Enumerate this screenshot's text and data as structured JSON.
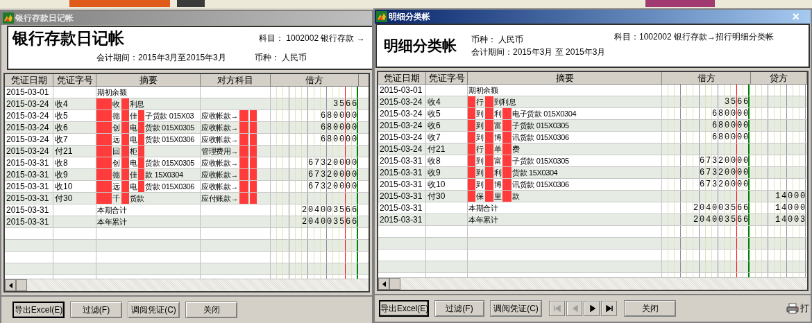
{
  "ledger_window": {
    "title": "银行存款日记帐",
    "active": false,
    "heading": "银行存款日记帐",
    "subject": "科目： 1002002 银行存款 →",
    "period": "会计期间：2015年3月至2015年3月",
    "currency": "币种： 人民币",
    "columns": [
      "凭证日期",
      "凭证字号",
      "摘要",
      "对方科目",
      "借方"
    ],
    "rows": [
      {
        "date": "2015-03-01",
        "summary": [
          {
            "kind": "text",
            "text": "期初余额"
          }
        ]
      },
      {
        "date": "2015-03-24",
        "voucher": "收4",
        "summary": [
          {
            "kind": "redacted"
          },
          {
            "kind": "text",
            "text": "收"
          },
          {
            "kind": "redacted"
          },
          {
            "kind": "text",
            "text": "利息"
          }
        ],
        "debit": "3566"
      },
      {
        "date": "2015-03-24",
        "voucher": "收5",
        "summary": [
          {
            "kind": "redacted"
          },
          {
            "kind": "text",
            "text": "德"
          },
          {
            "kind": "redacted"
          },
          {
            "kind": "text",
            "text": "佳"
          },
          {
            "kind": "redacted"
          },
          {
            "kind": "text",
            "text": "子货款 015X03"
          }
        ],
        "counterpart": [
          {
            "kind": "text",
            "text": "应收帐款→"
          },
          {
            "kind": "redacted"
          },
          {
            "kind": "redacted"
          }
        ],
        "debit": "680000"
      },
      {
        "date": "2015-03-24",
        "voucher": "收6",
        "summary": [
          {
            "kind": "redacted"
          },
          {
            "kind": "text",
            "text": "创"
          },
          {
            "kind": "redacted"
          },
          {
            "kind": "text",
            "text": "电"
          },
          {
            "kind": "redacted"
          },
          {
            "kind": "text",
            "text": "货款 015X0305"
          }
        ],
        "counterpart": [
          {
            "kind": "text",
            "text": "应收帐款→"
          },
          {
            "kind": "redacted"
          },
          {
            "kind": "redacted"
          }
        ],
        "debit": "680000"
      },
      {
        "date": "2015-03-24",
        "voucher": "收7",
        "summary": [
          {
            "kind": "redacted"
          },
          {
            "kind": "text",
            "text": "远"
          },
          {
            "kind": "redacted"
          },
          {
            "kind": "text",
            "text": "电"
          },
          {
            "kind": "redacted"
          },
          {
            "kind": "text",
            "text": "货款 015X0306"
          }
        ],
        "counterpart": [
          {
            "kind": "text",
            "text": "应收帐款→"
          },
          {
            "kind": "redacted"
          },
          {
            "kind": "redacted"
          }
        ],
        "debit": "680000"
      },
      {
        "date": "2015-03-24",
        "voucher": "付21",
        "summary": [
          {
            "kind": "redacted"
          },
          {
            "kind": "text",
            "text": "回"
          },
          {
            "kind": "redacted"
          },
          {
            "kind": "text",
            "text": "柜"
          },
          {
            "kind": "redacted"
          }
        ],
        "counterpart": [
          {
            "kind": "text",
            "text": "管理费用→"
          },
          {
            "kind": "redacted"
          },
          {
            "kind": "redacted"
          }
        ]
      },
      {
        "date": "2015-03-31",
        "voucher": "收8",
        "summary": [
          {
            "kind": "redacted"
          },
          {
            "kind": "text",
            "text": "创"
          },
          {
            "kind": "redacted"
          },
          {
            "kind": "text",
            "text": "电"
          },
          {
            "kind": "redacted"
          },
          {
            "kind": "text",
            "text": "货款 015X0305"
          }
        ],
        "counterpart": [
          {
            "kind": "text",
            "text": "应收帐款→"
          },
          {
            "kind": "redacted"
          },
          {
            "kind": "redacted"
          }
        ],
        "debit": "67320000"
      },
      {
        "date": "2015-03-31",
        "voucher": "收9",
        "summary": [
          {
            "kind": "redacted"
          },
          {
            "kind": "text",
            "text": "德"
          },
          {
            "kind": "redacted"
          },
          {
            "kind": "text",
            "text": "佳"
          },
          {
            "kind": "redacted"
          },
          {
            "kind": "text",
            "text": "款 15X0304"
          }
        ],
        "counterpart": [
          {
            "kind": "text",
            "text": "应收帐款→"
          },
          {
            "kind": "redacted"
          },
          {
            "kind": "redacted"
          }
        ],
        "debit": "67320000"
      },
      {
        "date": "2015-03-31",
        "voucher": "收10",
        "summary": [
          {
            "kind": "redacted"
          },
          {
            "kind": "text",
            "text": "远"
          },
          {
            "kind": "redacted"
          },
          {
            "kind": "text",
            "text": "电"
          },
          {
            "kind": "redacted"
          },
          {
            "kind": "text",
            "text": "货款 015X0306"
          }
        ],
        "counterpart": [
          {
            "kind": "text",
            "text": "应收帐款→"
          },
          {
            "kind": "redacted"
          },
          {
            "kind": "redacted"
          }
        ],
        "debit": "67320000"
      },
      {
        "date": "2015-03-31",
        "voucher": "付30",
        "summary": [
          {
            "kind": "redacted"
          },
          {
            "kind": "text",
            "text": "千"
          },
          {
            "kind": "redacted"
          },
          {
            "kind": "text",
            "text": "货款"
          }
        ],
        "counterpart": [
          {
            "kind": "text",
            "text": "应付账款→"
          },
          {
            "kind": "redacted"
          },
          {
            "kind": "redacted"
          }
        ]
      },
      {
        "date": "2015-03-31",
        "summary": [
          {
            "kind": "text",
            "text": "本期合计"
          }
        ],
        "debit": "204003566"
      },
      {
        "date": "2015-03-31",
        "summary": [
          {
            "kind": "text",
            "text": "本年累计"
          }
        ],
        "debit": "204003566"
      }
    ],
    "buttons": [
      {
        "label": "导出Excel(E)",
        "focused": true
      },
      {
        "label": "过滤(F)",
        "focused": false
      },
      {
        "label": "调阅凭证(C)",
        "focused": false
      },
      {
        "label": "关闭",
        "focused": false
      }
    ]
  },
  "detail_window": {
    "title": "明细分类帐",
    "active": true,
    "close_symbol": "×",
    "heading": "明细分类帐",
    "currency": "币种： 人民币",
    "period": "会计期间：2015年3月 至 2015年3月",
    "subject": "科目：1002002 银行存款→招行明细分类帐",
    "columns": [
      "凭证日期",
      "凭证字号",
      "摘要",
      "借方",
      "贷方"
    ],
    "rows": [
      {
        "date": "2015-03-01",
        "summary": [
          {
            "kind": "text",
            "text": "期初余额"
          }
        ]
      },
      {
        "date": "2015-03-24",
        "voucher": "收4",
        "summary": [
          {
            "kind": "redacted"
          },
          {
            "kind": "text",
            "text": "行"
          },
          {
            "kind": "redacted"
          },
          {
            "kind": "text",
            "text": "到利息"
          }
        ],
        "debit": "3566"
      },
      {
        "date": "2015-03-24",
        "voucher": "收5",
        "summary": [
          {
            "kind": "redacted"
          },
          {
            "kind": "text",
            "text": "到"
          },
          {
            "kind": "redacted"
          },
          {
            "kind": "text",
            "text": "利"
          },
          {
            "kind": "redacted"
          },
          {
            "kind": "text",
            "text": "电子货款 015X0304"
          }
        ],
        "debit": "680000"
      },
      {
        "date": "2015-03-24",
        "voucher": "收6",
        "summary": [
          {
            "kind": "redacted"
          },
          {
            "kind": "text",
            "text": "到"
          },
          {
            "kind": "redacted"
          },
          {
            "kind": "text",
            "text": "富"
          },
          {
            "kind": "redacted"
          },
          {
            "kind": "text",
            "text": "子货款 015X0305"
          }
        ],
        "debit": "680000"
      },
      {
        "date": "2015-03-24",
        "voucher": "收7",
        "summary": [
          {
            "kind": "redacted"
          },
          {
            "kind": "text",
            "text": "到"
          },
          {
            "kind": "redacted"
          },
          {
            "kind": "text",
            "text": "博"
          },
          {
            "kind": "redacted"
          },
          {
            "kind": "text",
            "text": "讯货款 015X0306"
          }
        ],
        "debit": "680000"
      },
      {
        "date": "2015-03-24",
        "voucher": "付21",
        "summary": [
          {
            "kind": "redacted"
          },
          {
            "kind": "text",
            "text": "行"
          },
          {
            "kind": "redacted"
          },
          {
            "kind": "text",
            "text": "单"
          },
          {
            "kind": "redacted"
          },
          {
            "kind": "text",
            "text": "费"
          }
        ]
      },
      {
        "date": "2015-03-31",
        "voucher": "收8",
        "summary": [
          {
            "kind": "redacted"
          },
          {
            "kind": "text",
            "text": "到"
          },
          {
            "kind": "redacted"
          },
          {
            "kind": "text",
            "text": "富"
          },
          {
            "kind": "redacted"
          },
          {
            "kind": "text",
            "text": "子货款 015X0305"
          }
        ],
        "debit": "67320000"
      },
      {
        "date": "2015-03-31",
        "voucher": "收9",
        "summary": [
          {
            "kind": "redacted"
          },
          {
            "kind": "text",
            "text": "到"
          },
          {
            "kind": "redacted"
          },
          {
            "kind": "text",
            "text": "利"
          },
          {
            "kind": "redacted"
          },
          {
            "kind": "text",
            "text": "货款 15X0304"
          }
        ],
        "debit": "67320000"
      },
      {
        "date": "2015-03-31",
        "voucher": "收10",
        "summary": [
          {
            "kind": "redacted"
          },
          {
            "kind": "text",
            "text": "到"
          },
          {
            "kind": "redacted"
          },
          {
            "kind": "text",
            "text": "博"
          },
          {
            "kind": "redacted"
          },
          {
            "kind": "text",
            "text": "讯货款 015X0306"
          }
        ],
        "debit": "67320000"
      },
      {
        "date": "2015-03-31",
        "voucher": "付30",
        "summary": [
          {
            "kind": "redacted"
          },
          {
            "kind": "text",
            "text": "保"
          },
          {
            "kind": "redacted"
          },
          {
            "kind": "text",
            "text": "里"
          },
          {
            "kind": "redacted"
          },
          {
            "kind": "text",
            "text": "款"
          }
        ],
        "credit": "14000"
      },
      {
        "date": "2015-03-31",
        "summary": [
          {
            "kind": "text",
            "text": "本期合计"
          }
        ],
        "debit": "204003566",
        "credit": "14000"
      },
      {
        "date": "2015-03-31",
        "summary": [
          {
            "kind": "text",
            "text": "本年累计"
          }
        ],
        "debit": "204003566",
        "credit": "14003"
      }
    ],
    "buttons": [
      {
        "label": "导出Excel(E)",
        "focused": true
      },
      {
        "label": "过滤(F)",
        "focused": false
      },
      {
        "label": "调阅凭证(C)",
        "focused": false
      }
    ],
    "nav": [
      {
        "kind": "first",
        "disabled": true
      },
      {
        "kind": "prev",
        "disabled": true
      },
      {
        "kind": "next",
        "disabled": false
      },
      {
        "kind": "last",
        "disabled": false
      }
    ],
    "close_button": "关闭",
    "print_button": "打"
  }
}
